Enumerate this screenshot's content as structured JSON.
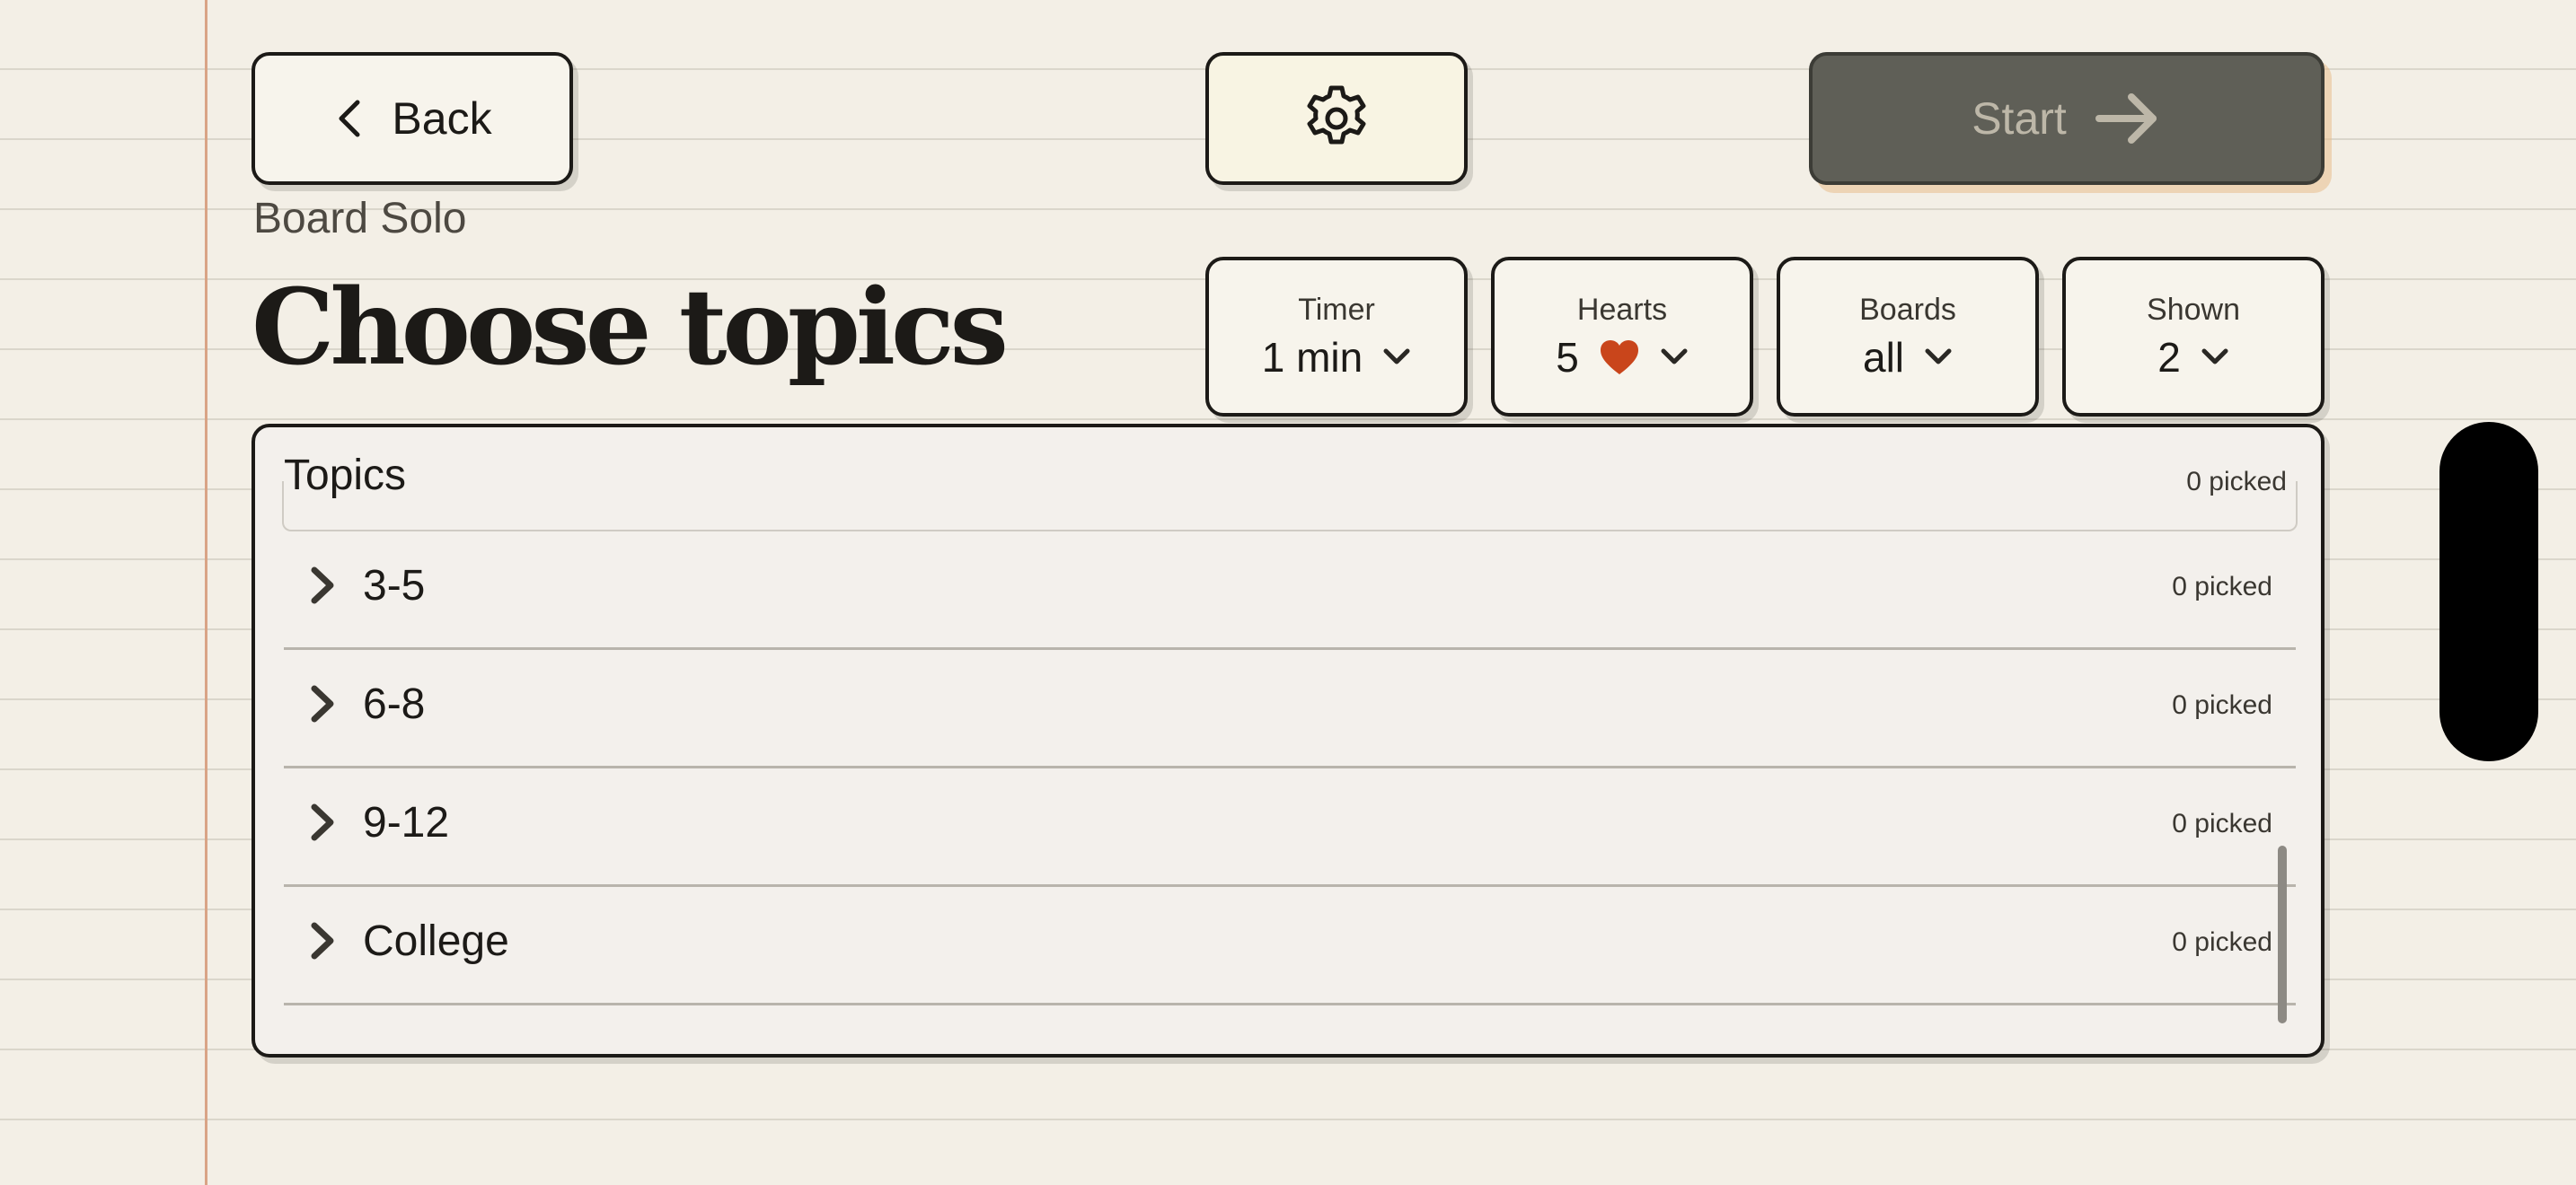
{
  "header": {
    "back_label": "Back",
    "start_label": "Start",
    "mode": "Board Solo",
    "title": "Choose topics"
  },
  "pickers": [
    {
      "label": "Timer",
      "value": "1 min"
    },
    {
      "label": "Hearts",
      "value": "5"
    },
    {
      "label": "Boards",
      "value": "all"
    },
    {
      "label": "Shown",
      "value": "2"
    }
  ],
  "panel": {
    "title": "Topics",
    "count": "0 picked",
    "rows": [
      {
        "label": "3-5",
        "count": "0 picked"
      },
      {
        "label": "6-8",
        "count": "0 picked"
      },
      {
        "label": "9-12",
        "count": "0 picked"
      },
      {
        "label": "College",
        "count": "0 picked"
      }
    ]
  },
  "icons": {
    "back": "chevron-left-icon",
    "settings": "gear-icon",
    "start": "arrow-right-icon",
    "dropdown": "chevron-down-icon",
    "hearts": "heart-icon",
    "expand": "chevron-right-icon"
  },
  "colors": {
    "heart": "#c9451b",
    "start_button": "#5f5f57",
    "page_background": "#f3efe6",
    "margin_line": "#d9a486"
  }
}
